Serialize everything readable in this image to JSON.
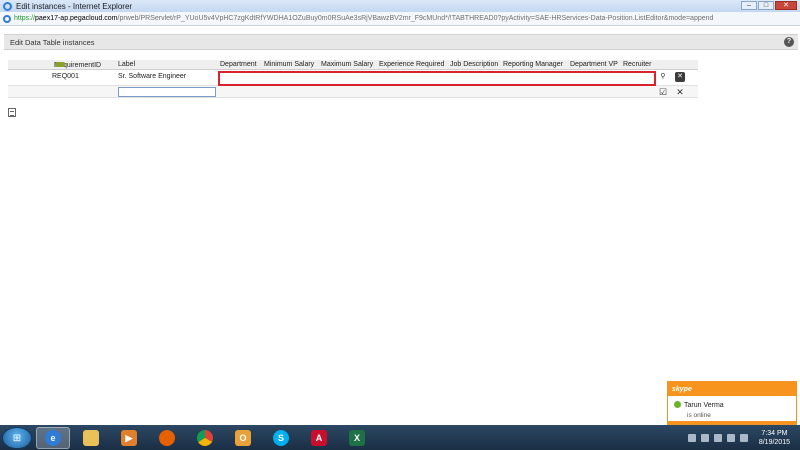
{
  "window": {
    "title": "Edit instances - Internet Explorer",
    "url_prefix": "https://",
    "url_host": "paex17-ap.pegacloud.com",
    "url_rest": "/prweb/PRServlet/rP_YUoU5v4VpHC7zgKdtRfYWDHA1OZuBuy0m0RSuAe3sRjVBawzBV2mr_F9cMUnd*/!TABTHREAD0?pyActivity=SAE-HRServices-Data-Position.ListEditor&mode=append"
  },
  "page": {
    "header_title": "Edit Data Table instances",
    "help_label": "?"
  },
  "grid": {
    "columns": [
      "RequirementID",
      "Label",
      "Department",
      "Minimum Salary",
      "Maximum Salary",
      "Experience Required",
      "Job Description",
      "Reporting Manager",
      "Department VP",
      "Recruiter"
    ],
    "row1": {
      "requirement_id": "REQ001",
      "label": "Sr. Software Engineer"
    },
    "row2": {
      "label_input_value": ""
    },
    "icons": {
      "search": "search-icon",
      "delete": "delete-icon",
      "save": "checkbox-icon",
      "cancel": "close-icon"
    }
  },
  "skype": {
    "logo": "skype",
    "contact_name": "Tarun Verma",
    "status": "is online"
  },
  "taskbar": {
    "time": "7:34 PM",
    "date": "8/19/2015"
  }
}
